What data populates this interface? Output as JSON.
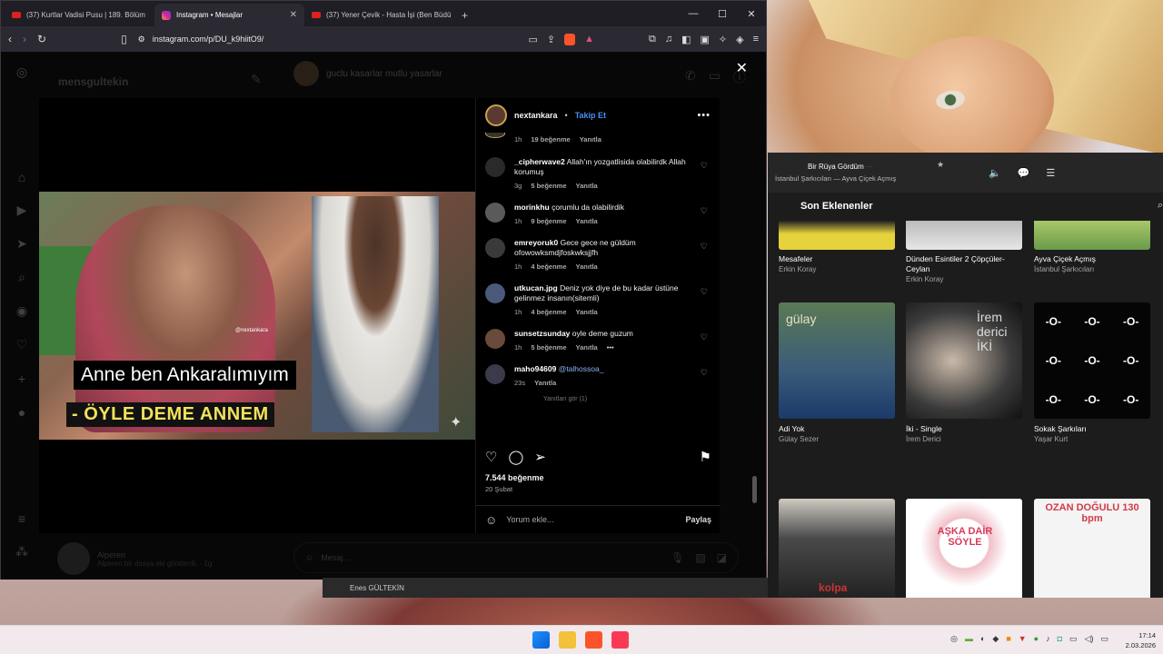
{
  "browser": {
    "tabs": [
      {
        "label": "(37) Kurtlar Vadisi Pusu | 189. Bölüm",
        "icon": "youtube-icon"
      },
      {
        "label": "Instagram • Mesajlar",
        "icon": "instagram-icon"
      },
      {
        "label": "(37) Yener Çevik - Hasta İşi (Ben Büdü",
        "icon": "youtube-icon"
      }
    ],
    "url": "instagram.com/p/DU_k9hiitO9/"
  },
  "instagram": {
    "username": "mensgultekin",
    "chat_name": "guclu kasarlar mutlu yasarlar",
    "bottom_user_name": "Alperen",
    "bottom_user_sub": "Alperen bir dosya eki gönderdi. · 1g",
    "message_placeholder": "Mesaj..."
  },
  "post": {
    "author": "nextankara",
    "follow_label": "Takip Et",
    "watermark": "@nextankara",
    "subtitle_1": "Anne ben Ankaralımıyım",
    "subtitle_2": "- ÖYLE DEME ANNEM",
    "likes": "7.544 beğenme",
    "date": "20 Şubat",
    "add_comment_placeholder": "Yorum ekle...",
    "share_label": "Paylaş",
    "first_meta": {
      "time": "1h",
      "likes": "19 beğenme",
      "reply": "Yanıtla"
    },
    "comments": [
      {
        "user": "_cipherwave2",
        "text": "Allah'ın yozgatlisida olabilirdk Allah korumuş",
        "time": "3g",
        "likes": "5 beğenme",
        "reply": "Yanıtla",
        "avatar": "#2a2a2a"
      },
      {
        "user": "morinkhu",
        "text": "çorumlu da olabilirdik",
        "time": "1h",
        "likes": "9 beğenme",
        "reply": "Yanıtla",
        "avatar": "#5a5a5a"
      },
      {
        "user": "emreyoruk0",
        "text": "Gece gece ne güldüm ofowowksmdjfoskwksjjfh",
        "time": "1h",
        "likes": "4 beğenme",
        "reply": "Yanıtla",
        "avatar": "#3a3a3a"
      },
      {
        "user": "utkucan.jpg",
        "text": "Deniz yok diye de bu kadar üstüne gelinmez insanın(sitemli)",
        "time": "1h",
        "likes": "4 beğenme",
        "reply": "Yanıtla",
        "avatar": "#4a5a7a"
      },
      {
        "user": "sunsetzsunday",
        "text": "oyle deme guzum",
        "time": "1h",
        "likes": "5 beğenme",
        "reply": "Yanıtla",
        "avatar": "#6a4a3a"
      },
      {
        "user": "maho94609",
        "text": "@talhossoa_",
        "time": "23s",
        "likes": "",
        "reply": "Yanıtla",
        "avatar": "#3a3a4a"
      }
    ],
    "more_replies": "Yanıtları gör (1)"
  },
  "music": {
    "now_playing_title": "Bir Rüya Gördüm",
    "now_playing_artist": "İstanbul Şarkıcıları — Ayva Çiçek Açmış",
    "section": "Son Eklenenler",
    "top_row": [
      {
        "title": "Mesafeler",
        "artist": "Erkin Koray"
      },
      {
        "title": "Dünden Esintiler 2 Çöpçüler-Ceylan",
        "artist": "Erkin Koray"
      },
      {
        "title": "Ayva Çiçek Açmış",
        "artist": "İstanbul Şarkıcıları"
      }
    ],
    "mid_row": [
      {
        "title": "Adi Yok",
        "artist": "Gülay Sezer",
        "cover_text": "gülay"
      },
      {
        "title": "İki - Single",
        "artist": "İrem Derici",
        "cover_text": "İrem derici İKİ"
      },
      {
        "title": "Sokak Şarkıları",
        "artist": "Yaşar Kurt",
        "cover_text": "-O-"
      }
    ],
    "bottom_covers": [
      "kolpa",
      "AŞKA DAİR SÖYLE",
      "OZAN DOĞULU 130 bpm"
    ]
  },
  "other_window": "Enes GÜLTEKİN",
  "clock": {
    "time": "17:14",
    "date": "2.03.2026"
  }
}
